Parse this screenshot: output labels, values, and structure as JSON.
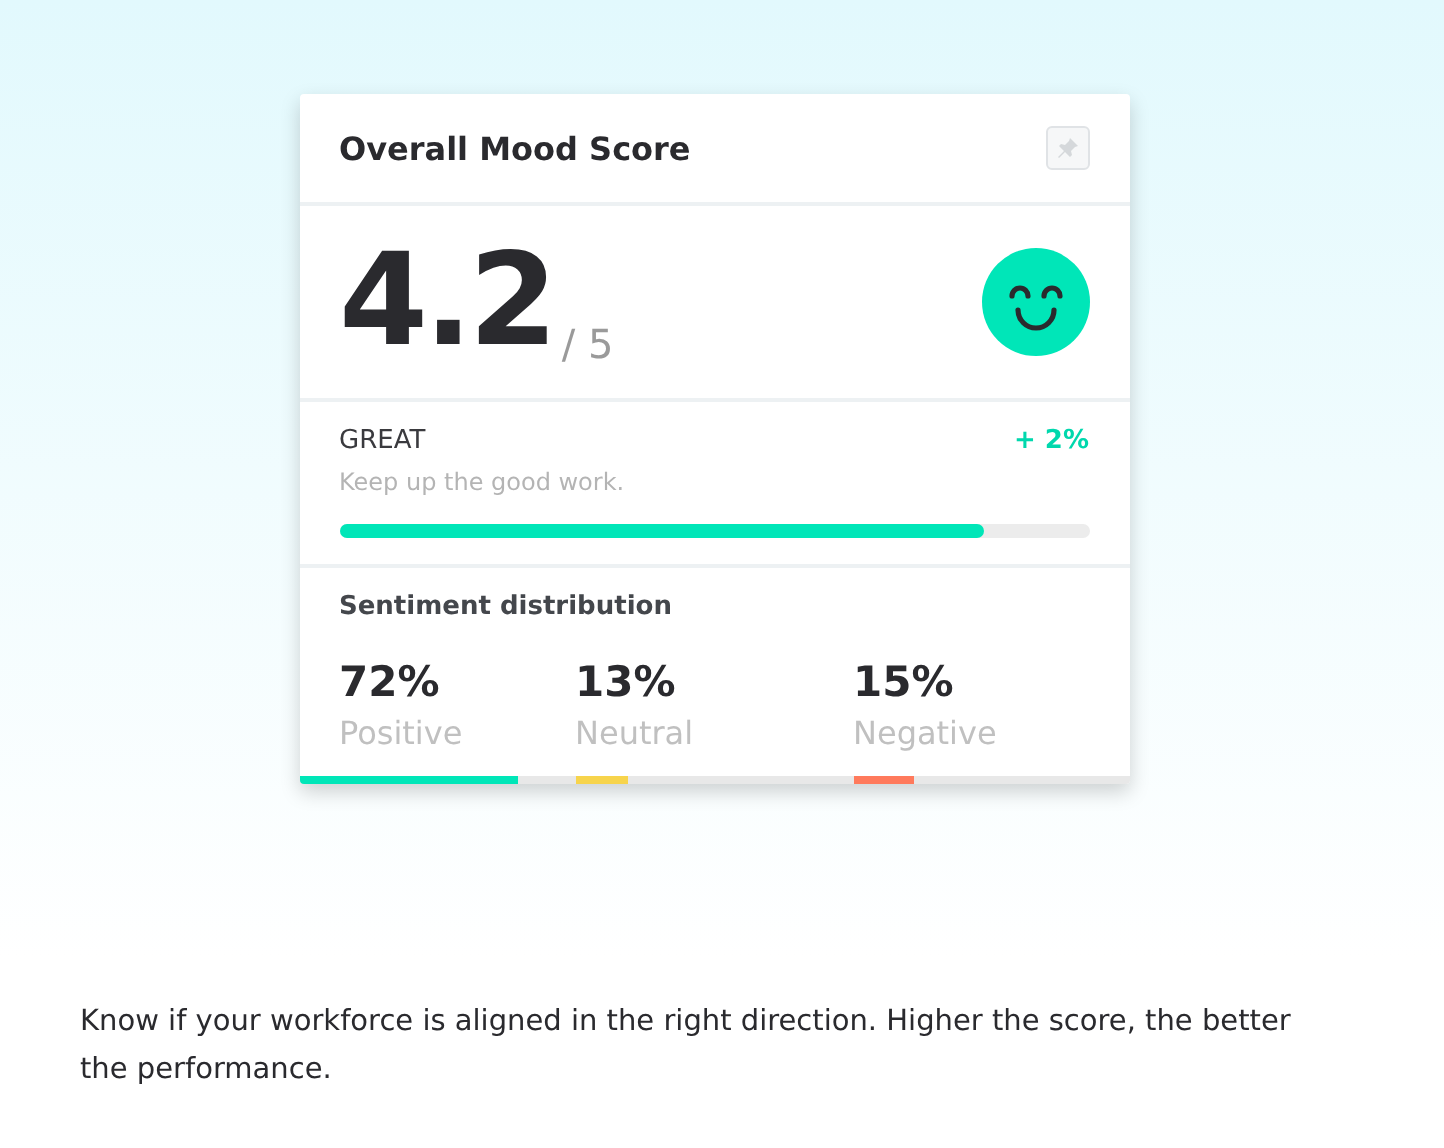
{
  "card": {
    "title": "Overall Mood Score",
    "score": "4.2",
    "score_max": "/ 5",
    "rating": {
      "label": "GREAT",
      "change": "+ 2%",
      "message": "Keep up the good work.",
      "level": 0.86
    },
    "sentiment": {
      "title": "Sentiment distribution",
      "items": [
        {
          "value": "72%",
          "label": "Positive",
          "color": "#00e6b8",
          "level": 0.79
        },
        {
          "value": "13%",
          "label": "Neutral",
          "color": "#f7d44c",
          "level": 0.19
        },
        {
          "value": "15%",
          "label": "Negative",
          "color": "#ff7a5c",
          "level": 0.22
        }
      ]
    }
  },
  "caption": "Know if your workforce is aligned in the right direction. Higher the score, the better the performance."
}
